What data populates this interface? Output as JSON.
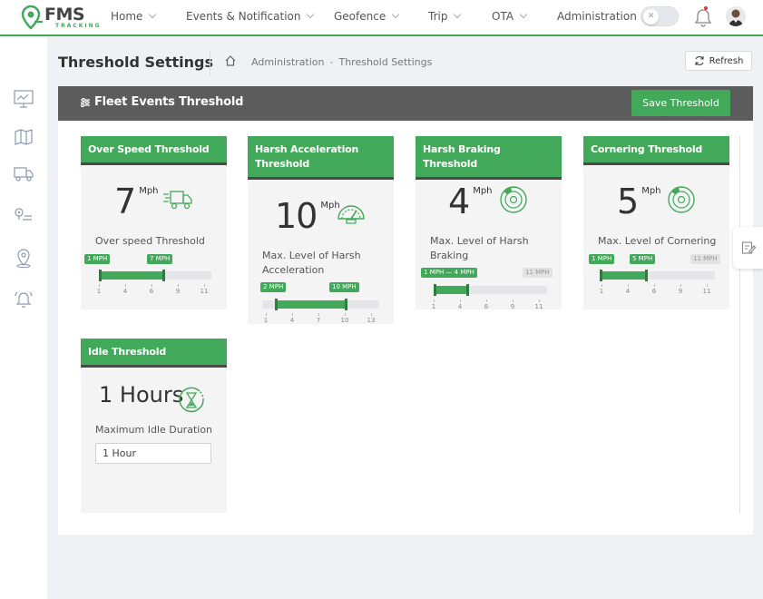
{
  "brand": {
    "name": "FMS",
    "sub": "TRACKING"
  },
  "nav": [
    {
      "label": "Home"
    },
    {
      "label": "Events & Notification"
    },
    {
      "label": "Geofence"
    },
    {
      "label": "Trip"
    },
    {
      "label": "OTA"
    },
    {
      "label": "Administration"
    }
  ],
  "colors": {
    "accent": "#43a95a",
    "header_dark": "#5c5c5c"
  },
  "header": {
    "title": "Threshold Settings",
    "breadcrumb": [
      "Administration",
      "Threshold Settings"
    ],
    "refresh_label": "Refresh"
  },
  "panel": {
    "title": "Fleet Events Threshold",
    "save_label": "Save Threshold"
  },
  "cards": [
    {
      "title": "Over Speed Threshold",
      "value": "7",
      "unit": "Mph",
      "label": "Over speed Threshold",
      "slider": {
        "min_tag": "1 MPH",
        "max_tag": "7 MPH",
        "ticks": [
          "1",
          "4",
          "6",
          "9",
          "11"
        ]
      },
      "icon": "speeding-truck-icon"
    },
    {
      "title": "Harsh Acceleration Threshold",
      "value": "10",
      "unit": "Mph",
      "label": "Max. Level of Harsh Acceleration",
      "slider": {
        "min_tag": "2 MPH",
        "max_tag": "10 MPH",
        "ticks": [
          "1",
          "4",
          "7",
          "10",
          "13"
        ]
      },
      "icon": "speedometer-icon"
    },
    {
      "title": "Harsh Braking Threshold",
      "value": "4",
      "unit": "Mph",
      "label": "Max. Level of Harsh Braking",
      "slider": {
        "range_tag": "1 MPH — 4 MPH",
        "limit_tag": "11 MPH",
        "ticks": [
          "1",
          "4",
          "6",
          "9",
          "11"
        ]
      },
      "icon": "brake-disc-icon"
    },
    {
      "title": "Cornering Threshold",
      "value": "5",
      "unit": "Mph",
      "label": "Max. Level of Cornering",
      "slider": {
        "min_tag": "1 MPH",
        "max_tag": "5 MPH",
        "limit_tag": "11 MPH",
        "ticks": [
          "1",
          "4",
          "6",
          "9",
          "11"
        ]
      },
      "icon": "brake-disc-icon"
    },
    {
      "title": "Idle Threshold",
      "value": "1 Hours",
      "label": "Maximum Idle Duration",
      "input_value": "1 Hour",
      "icon": "hourglass-icon"
    }
  ]
}
